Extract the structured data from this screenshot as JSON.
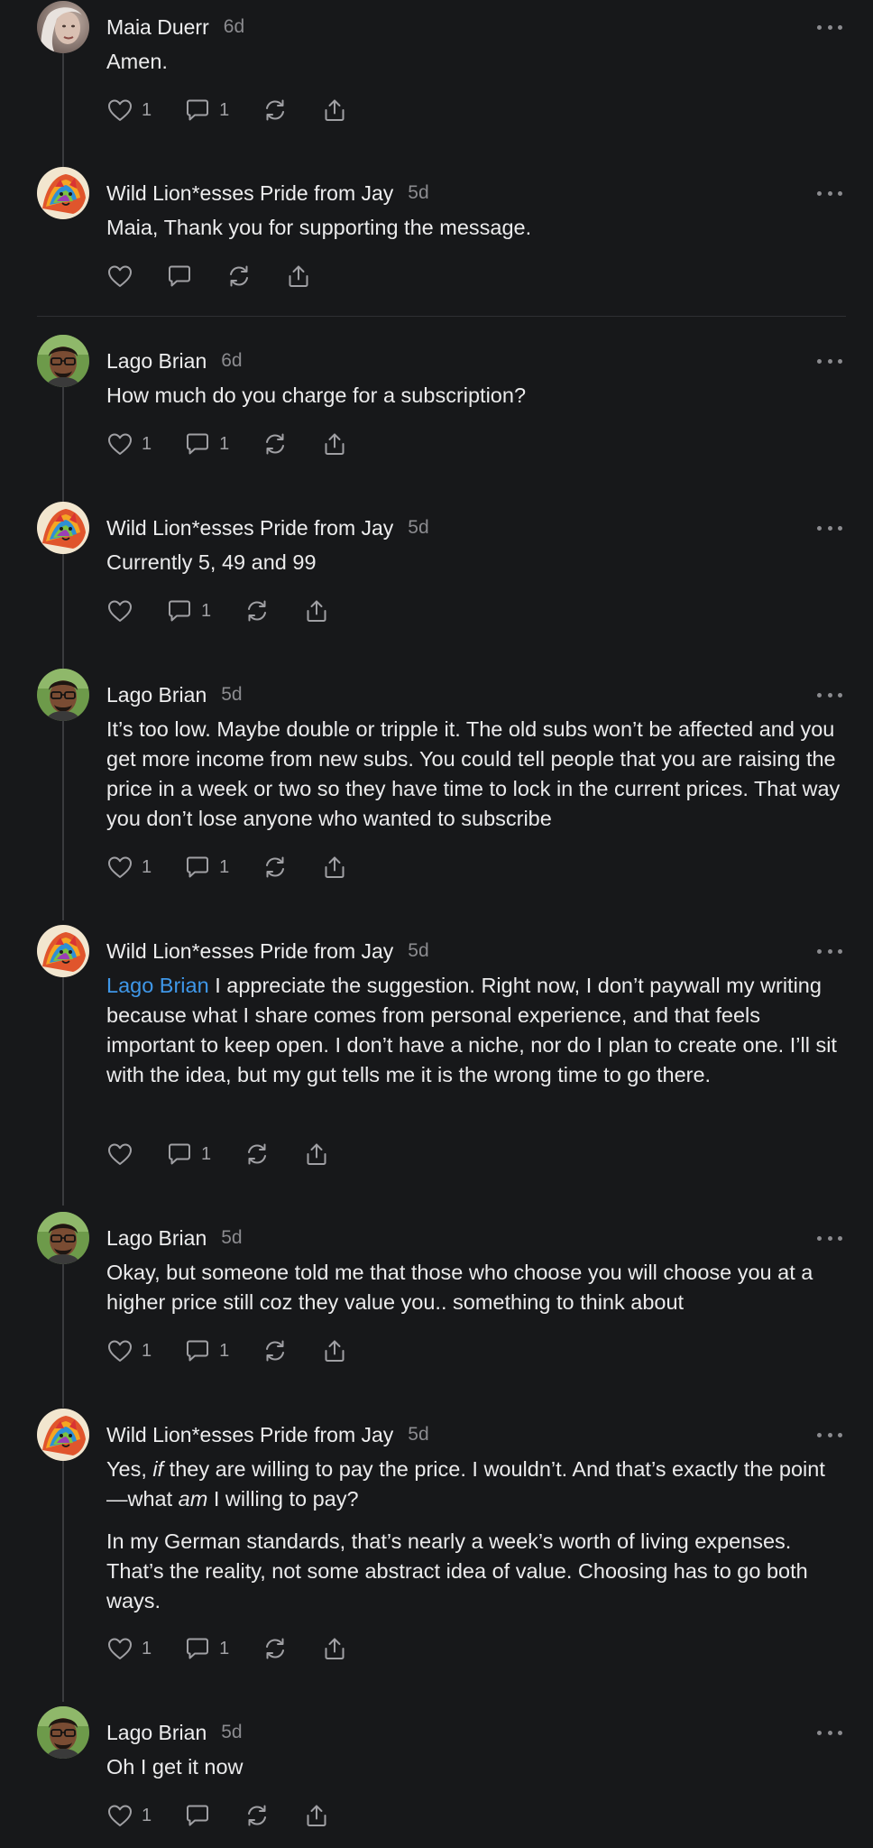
{
  "thread": {
    "comments": [
      {
        "author": "Maia Duerr",
        "time": "6d",
        "avatar": "maia-photo",
        "paragraphs": [
          "Amen."
        ],
        "likes": "1",
        "replies": "1"
      },
      {
        "author": "Wild Lion*esses Pride from Jay",
        "time": "5d",
        "avatar": "lioness-art",
        "paragraphs": [
          "Maia, Thank you for supporting the message."
        ],
        "likes": "",
        "replies": ""
      },
      {
        "author": "Lago Brian",
        "time": "6d",
        "avatar": "brian-photo",
        "paragraphs": [
          "How much do you charge for a subscription?"
        ],
        "likes": "1",
        "replies": "1"
      },
      {
        "author": "Wild Lion*esses Pride from Jay",
        "time": "5d",
        "avatar": "lioness-art",
        "paragraphs": [
          "Currently 5, 49 and 99"
        ],
        "likes": "",
        "replies": "1"
      },
      {
        "author": "Lago Brian",
        "time": "5d",
        "avatar": "brian-photo",
        "paragraphs": [
          "It’s too low. Maybe double or tripple it. The old subs won’t be affected and you get more income from new subs. You could tell people that you are raising the price in a week or two so they have time to lock in the current prices. That way you don’t lose anyone who wanted to subscribe"
        ],
        "likes": "1",
        "replies": "1"
      },
      {
        "author": "Wild Lion*esses Pride from Jay",
        "time": "5d",
        "avatar": "lioness-art",
        "mention": "Lago Brian",
        "paragraphs": [
          "I appreciate the suggestion. Right now, I don’t paywall my writing because what I share comes from personal experience, and that feels important to keep open. I don’t have a niche, nor do I plan to create one. I’ll sit with the idea, but my gut tells me it is the wrong time to go there."
        ],
        "likes": "",
        "replies": "1"
      },
      {
        "author": "Lago Brian",
        "time": "5d",
        "avatar": "brian-photo",
        "paragraphs": [
          "Okay, but someone told me that those who choose you will choose you at a higher price still coz they value you.. something to think about"
        ],
        "likes": "1",
        "replies": "1"
      },
      {
        "author": "Wild Lion*esses Pride from Jay",
        "time": "5d",
        "avatar": "lioness-art",
        "paragraphs": [
          "Yes, |if| they are willing to pay the price. I wouldn’t. And that’s exactly the point—what |am| I willing to pay?",
          "In my German standards, that’s nearly a week’s worth of living expenses. That’s the reality, not some abstract idea of value. Choosing has to go both ways."
        ],
        "likes": "1",
        "replies": "1"
      },
      {
        "author": "Lago Brian",
        "time": "5d",
        "avatar": "brian-photo",
        "paragraphs": [
          "Oh I get it now"
        ],
        "likes": "1",
        "replies": ""
      }
    ]
  },
  "icons": {
    "like": "heart-icon",
    "reply": "comment-bubble-icon",
    "restack": "restack-icon",
    "share": "share-icon",
    "more": "more-options-icon"
  },
  "colors": {
    "background": "#17181a",
    "text": "#ebebec",
    "muted": "#8b8b8f",
    "mention": "#3f97e8"
  }
}
